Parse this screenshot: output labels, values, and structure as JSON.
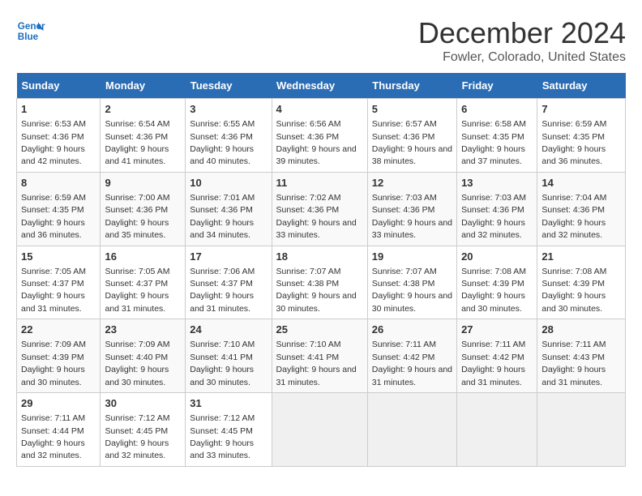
{
  "logo": {
    "line1": "General",
    "line2": "Blue"
  },
  "title": "December 2024",
  "subtitle": "Fowler, Colorado, United States",
  "days_header": [
    "Sunday",
    "Monday",
    "Tuesday",
    "Wednesday",
    "Thursday",
    "Friday",
    "Saturday"
  ],
  "weeks": [
    [
      {
        "day": "1",
        "sunrise": "6:53 AM",
        "sunset": "4:36 PM",
        "daylight": "9 hours and 42 minutes."
      },
      {
        "day": "2",
        "sunrise": "6:54 AM",
        "sunset": "4:36 PM",
        "daylight": "9 hours and 41 minutes."
      },
      {
        "day": "3",
        "sunrise": "6:55 AM",
        "sunset": "4:36 PM",
        "daylight": "9 hours and 40 minutes."
      },
      {
        "day": "4",
        "sunrise": "6:56 AM",
        "sunset": "4:36 PM",
        "daylight": "9 hours and 39 minutes."
      },
      {
        "day": "5",
        "sunrise": "6:57 AM",
        "sunset": "4:36 PM",
        "daylight": "9 hours and 38 minutes."
      },
      {
        "day": "6",
        "sunrise": "6:58 AM",
        "sunset": "4:35 PM",
        "daylight": "9 hours and 37 minutes."
      },
      {
        "day": "7",
        "sunrise": "6:59 AM",
        "sunset": "4:35 PM",
        "daylight": "9 hours and 36 minutes."
      }
    ],
    [
      {
        "day": "8",
        "sunrise": "6:59 AM",
        "sunset": "4:35 PM",
        "daylight": "9 hours and 36 minutes."
      },
      {
        "day": "9",
        "sunrise": "7:00 AM",
        "sunset": "4:36 PM",
        "daylight": "9 hours and 35 minutes."
      },
      {
        "day": "10",
        "sunrise": "7:01 AM",
        "sunset": "4:36 PM",
        "daylight": "9 hours and 34 minutes."
      },
      {
        "day": "11",
        "sunrise": "7:02 AM",
        "sunset": "4:36 PM",
        "daylight": "9 hours and 33 minutes."
      },
      {
        "day": "12",
        "sunrise": "7:03 AM",
        "sunset": "4:36 PM",
        "daylight": "9 hours and 33 minutes."
      },
      {
        "day": "13",
        "sunrise": "7:03 AM",
        "sunset": "4:36 PM",
        "daylight": "9 hours and 32 minutes."
      },
      {
        "day": "14",
        "sunrise": "7:04 AM",
        "sunset": "4:36 PM",
        "daylight": "9 hours and 32 minutes."
      }
    ],
    [
      {
        "day": "15",
        "sunrise": "7:05 AM",
        "sunset": "4:37 PM",
        "daylight": "9 hours and 31 minutes."
      },
      {
        "day": "16",
        "sunrise": "7:05 AM",
        "sunset": "4:37 PM",
        "daylight": "9 hours and 31 minutes."
      },
      {
        "day": "17",
        "sunrise": "7:06 AM",
        "sunset": "4:37 PM",
        "daylight": "9 hours and 31 minutes."
      },
      {
        "day": "18",
        "sunrise": "7:07 AM",
        "sunset": "4:38 PM",
        "daylight": "9 hours and 30 minutes."
      },
      {
        "day": "19",
        "sunrise": "7:07 AM",
        "sunset": "4:38 PM",
        "daylight": "9 hours and 30 minutes."
      },
      {
        "day": "20",
        "sunrise": "7:08 AM",
        "sunset": "4:39 PM",
        "daylight": "9 hours and 30 minutes."
      },
      {
        "day": "21",
        "sunrise": "7:08 AM",
        "sunset": "4:39 PM",
        "daylight": "9 hours and 30 minutes."
      }
    ],
    [
      {
        "day": "22",
        "sunrise": "7:09 AM",
        "sunset": "4:39 PM",
        "daylight": "9 hours and 30 minutes."
      },
      {
        "day": "23",
        "sunrise": "7:09 AM",
        "sunset": "4:40 PM",
        "daylight": "9 hours and 30 minutes."
      },
      {
        "day": "24",
        "sunrise": "7:10 AM",
        "sunset": "4:41 PM",
        "daylight": "9 hours and 30 minutes."
      },
      {
        "day": "25",
        "sunrise": "7:10 AM",
        "sunset": "4:41 PM",
        "daylight": "9 hours and 31 minutes."
      },
      {
        "day": "26",
        "sunrise": "7:11 AM",
        "sunset": "4:42 PM",
        "daylight": "9 hours and 31 minutes."
      },
      {
        "day": "27",
        "sunrise": "7:11 AM",
        "sunset": "4:42 PM",
        "daylight": "9 hours and 31 minutes."
      },
      {
        "day": "28",
        "sunrise": "7:11 AM",
        "sunset": "4:43 PM",
        "daylight": "9 hours and 31 minutes."
      }
    ],
    [
      {
        "day": "29",
        "sunrise": "7:11 AM",
        "sunset": "4:44 PM",
        "daylight": "9 hours and 32 minutes."
      },
      {
        "day": "30",
        "sunrise": "7:12 AM",
        "sunset": "4:45 PM",
        "daylight": "9 hours and 32 minutes."
      },
      {
        "day": "31",
        "sunrise": "7:12 AM",
        "sunset": "4:45 PM",
        "daylight": "9 hours and 33 minutes."
      },
      null,
      null,
      null,
      null
    ]
  ],
  "labels": {
    "sunrise": "Sunrise:",
    "sunset": "Sunset:",
    "daylight": "Daylight:"
  }
}
